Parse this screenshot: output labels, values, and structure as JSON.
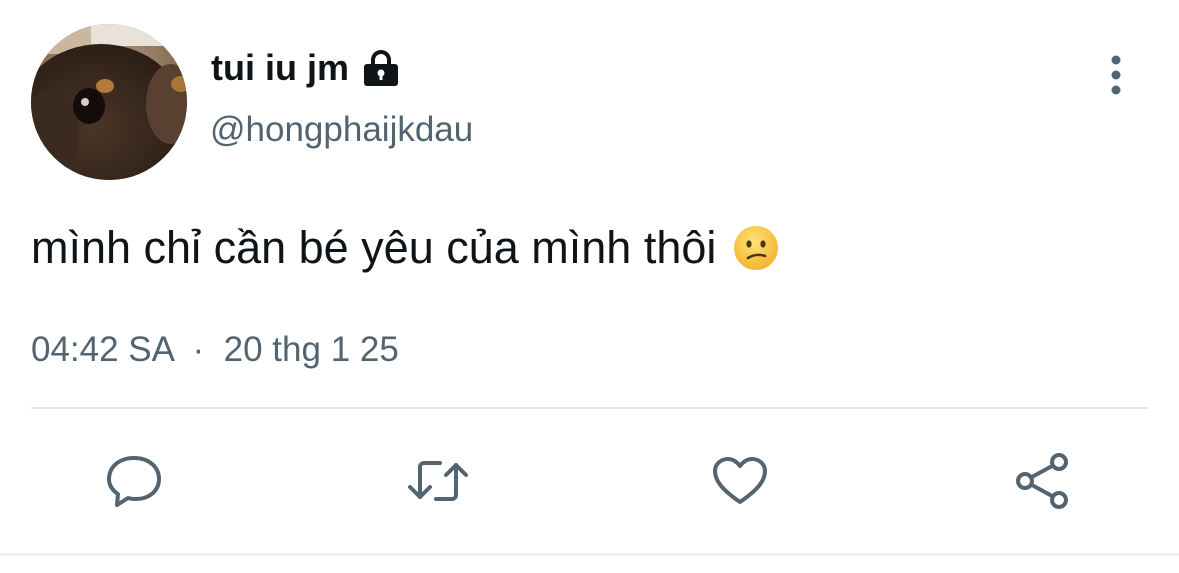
{
  "user": {
    "display_name": "tui iu jm",
    "handle": "@hongphaijkdau",
    "avatar": "avatar",
    "protected_icon": "lock-icon"
  },
  "tweet": {
    "text": "mình chỉ cần bé yêu của mình thôi",
    "emoji": "confused-face-emoji",
    "time": "04:42 SA",
    "separator": "·",
    "date": "20 thg 1 25"
  },
  "actions": [
    {
      "name": "reply",
      "icon": "comment-icon"
    },
    {
      "name": "retweet",
      "icon": "retweet-icon"
    },
    {
      "name": "like",
      "icon": "heart-icon"
    },
    {
      "name": "share",
      "icon": "share-icon"
    }
  ],
  "colors": {
    "text": "#0f1419",
    "secondary": "#536471",
    "icon": "#536471",
    "divider": "#e7e9eb"
  }
}
